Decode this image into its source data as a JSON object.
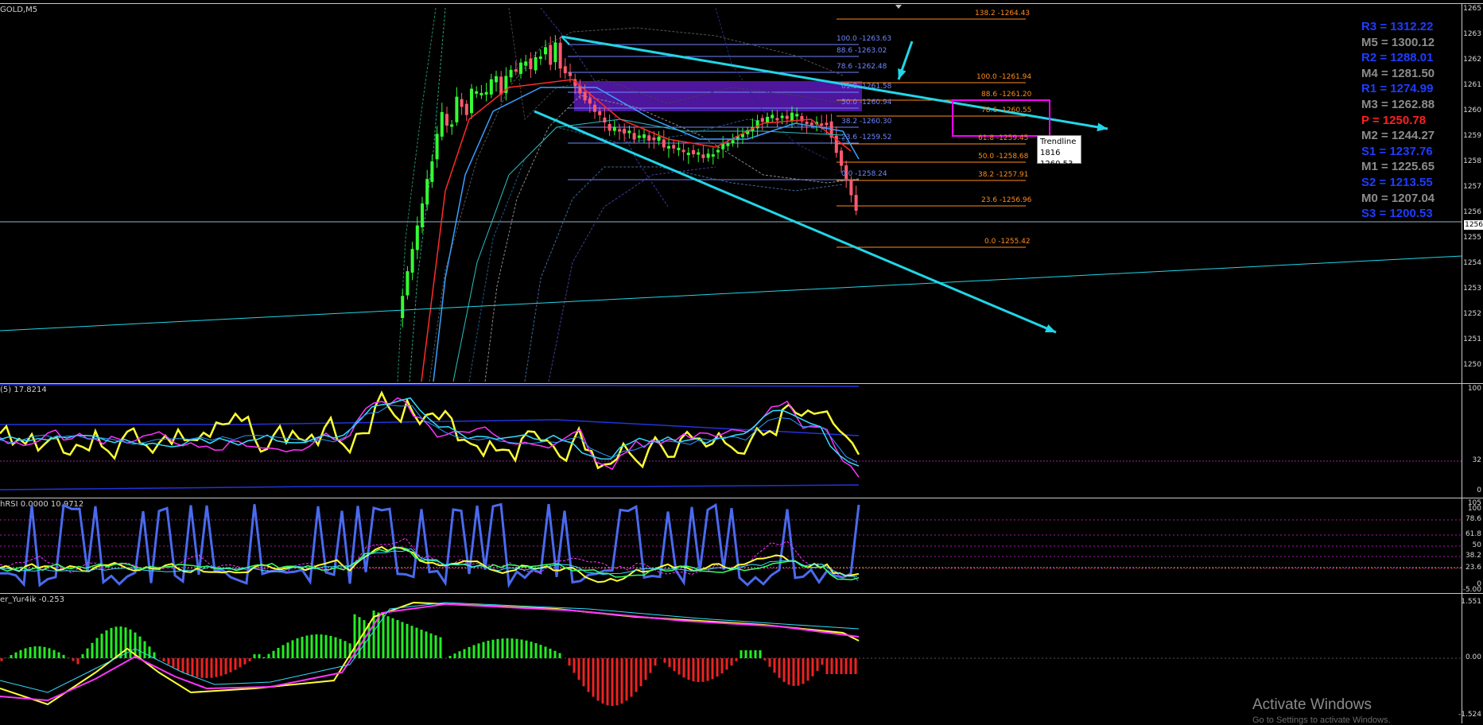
{
  "window": {
    "symbol_label": "GOLD,M5"
  },
  "panes": {
    "indicator1_label": "(5) 17.8214",
    "indicator2_label": "hRSI 0.0000 10.9712",
    "indicator3_label": "er_Yur4ik -0.253"
  },
  "price_scale": {
    "ticks": [
      "1265",
      "1263",
      "1262",
      "1261",
      "1260",
      "1259",
      "1258",
      "1257",
      "1256",
      "1255",
      "1254",
      "1253",
      "1252",
      "1251",
      "1250"
    ],
    "current": "1256"
  },
  "ind1_scale": [
    "100",
    "32",
    "0"
  ],
  "ind2_scale": [
    "105",
    "100",
    "78.6",
    "61.8",
    "50",
    "38.2",
    "23.6",
    "0",
    "-5.00"
  ],
  "ind3_scale": [
    "1.551",
    "0.00",
    "-1.524"
  ],
  "fib_right": [
    {
      "label": "138.2 -1264.43"
    },
    {
      "label": "100.0 -1261.94"
    },
    {
      "label": "88.6 -1261.20"
    },
    {
      "label": "78.6 -1260.55"
    },
    {
      "label": "61.8 -1259.45"
    },
    {
      "label": "50.0 -1258.68"
    },
    {
      "label": "38.2 -1257.91"
    },
    {
      "label": "23.6 -1256.96"
    },
    {
      "label": "0.0 -1255.42"
    }
  ],
  "fib_left": [
    {
      "label": "100.0 -1263.63"
    },
    {
      "label": "88.6 -1263.02"
    },
    {
      "label": "78.6 -1262.48"
    },
    {
      "label": "61.8 -1261.58"
    },
    {
      "label": "50.0 -1260.94"
    },
    {
      "label": "38.2 -1260.30"
    },
    {
      "label": "23.6 -1259.52"
    },
    {
      "label": "0.0 -1258.24"
    }
  ],
  "pivots": [
    {
      "label": "R3 = 1312.22",
      "color": "#1f3cff"
    },
    {
      "label": "M5 = 1300.12",
      "color": "#8c8c8c"
    },
    {
      "label": "R2 = 1288.01",
      "color": "#1f3cff"
    },
    {
      "label": "M4 = 1281.50",
      "color": "#8c8c8c"
    },
    {
      "label": "R1 = 1274.99",
      "color": "#1f3cff"
    },
    {
      "label": "M3 = 1262.88",
      "color": "#8c8c8c"
    },
    {
      "label": "P  = 1250.78",
      "color": "#ff2020"
    },
    {
      "label": "M2 = 1244.27",
      "color": "#8c8c8c"
    },
    {
      "label": "S1 = 1237.76",
      "color": "#1f3cff"
    },
    {
      "label": "M1 = 1225.65",
      "color": "#8c8c8c"
    },
    {
      "label": "S2 = 1213.55",
      "color": "#1f3cff"
    },
    {
      "label": "M0 = 1207.04",
      "color": "#8c8c8c"
    },
    {
      "label": "S3 = 1200.53",
      "color": "#1f3cff"
    }
  ],
  "tooltip": {
    "line1": "Trendline 1816",
    "line2": "1260.53"
  },
  "watermark": {
    "title": "Activate Windows",
    "subtitle": "Go to Settings to activate Windows."
  },
  "colors": {
    "bull": "#33ff33",
    "bear": "#ff5a6e",
    "trend": "#22d6e8",
    "fib_right": "#ff8c1a",
    "fib_left": "#6f86ff",
    "box": "#ff00ff",
    "zone": "#5a1ab8"
  }
}
